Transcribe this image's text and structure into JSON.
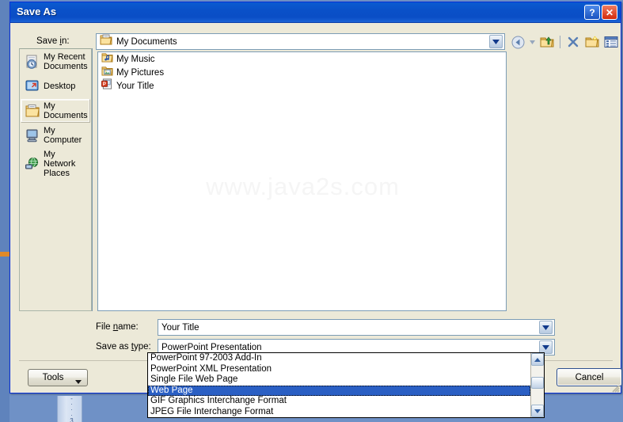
{
  "dialog": {
    "title": "Save As",
    "help_button": "?",
    "close_button": "✕"
  },
  "save_in": {
    "label_pre": "Save ",
    "label_underline": "i",
    "label_post": "n:",
    "value": "My Documents",
    "icon": "my-documents-folder-icon"
  },
  "toolbar": {
    "back_icon": "back-arrow-icon",
    "back_dropdown_icon": "chevron-down-icon",
    "up_icon": "up-one-level-icon",
    "delete_icon": "delete-x-icon",
    "new_folder_icon": "new-folder-icon",
    "views_icon": "views-icon",
    "views_dropdown_icon": "chevron-down-icon"
  },
  "places_bar": {
    "items": [
      {
        "label": "My Recent Documents",
        "icon": "recent-documents-icon",
        "selected": false
      },
      {
        "label": "Desktop",
        "icon": "desktop-icon",
        "selected": false
      },
      {
        "label": "My Documents",
        "icon": "my-documents-icon",
        "selected": true
      },
      {
        "label": "My Computer",
        "icon": "my-computer-icon",
        "selected": false
      },
      {
        "label": "My Network Places",
        "icon": "network-places-icon",
        "selected": false
      }
    ]
  },
  "file_list": {
    "items": [
      {
        "name": "My Music",
        "icon": "music-folder-icon"
      },
      {
        "name": "My Pictures",
        "icon": "pictures-folder-icon"
      },
      {
        "name": "Your Title",
        "icon": "powerpoint-file-icon"
      }
    ],
    "watermark": "www.java2s.com"
  },
  "file_name": {
    "label_pre": "File ",
    "label_underline": "n",
    "label_post": "ame:",
    "value": "Your Title"
  },
  "save_as_type": {
    "label_pre": "Save as ",
    "label_underline": "t",
    "label_post": "ype:",
    "value": "PowerPoint Presentation",
    "options": [
      {
        "label": "PowerPoint 97-2003 Add-In",
        "selected": false
      },
      {
        "label": "PowerPoint XML Presentation",
        "selected": false
      },
      {
        "label": "Single File Web Page",
        "selected": false
      },
      {
        "label": "Web Page",
        "selected": true
      },
      {
        "label": "GIF Graphics Interchange Format",
        "selected": false
      },
      {
        "label": "JPEG File Interchange Format",
        "selected": false
      }
    ]
  },
  "footer": {
    "tools_label": "Tools",
    "tools_caret": "▼",
    "cancel_label": "Cancel"
  },
  "background": {
    "ruler_ticks": [
      "-",
      "·",
      "·",
      "·",
      "3"
    ]
  },
  "colors": {
    "titlebar_blue": "#0a50c8",
    "dialog_face": "#ece9d8",
    "selection_blue": "#2a5fc4",
    "field_border": "#7c9cb5"
  }
}
